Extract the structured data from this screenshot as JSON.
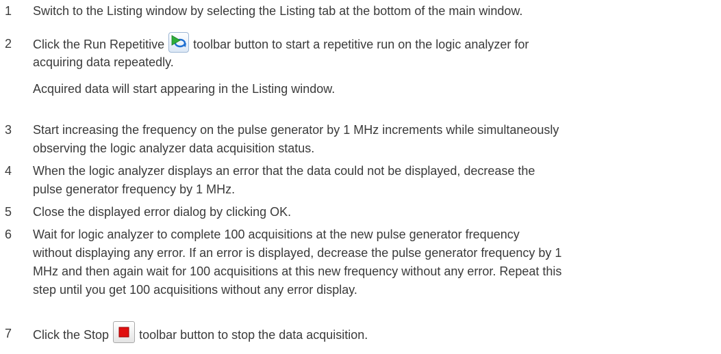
{
  "steps": [
    {
      "number": "1",
      "lines": [
        "Switch to the Listing window by selecting the Listing tab at the bottom of the main window."
      ]
    },
    {
      "number": "2",
      "line1_before": "Click the Run Repetitive",
      "line1_after": "toolbar button to start a repetitive run on the logic analyzer for",
      "line2": "acquiring data repeatedly.",
      "note": "Acquired data will start appearing in the Listing window.",
      "icon": "run-repetitive-icon"
    },
    {
      "number": "3",
      "lines": [
        "Start increasing the frequency on the pulse generator by 1 MHz increments while simultaneously",
        "observing the logic analyzer data acquisition status."
      ]
    },
    {
      "number": "4",
      "lines": [
        "When the logic analyzer displays an error that the data could not be displayed, decrease the",
        "pulse generator frequency by 1 MHz."
      ]
    },
    {
      "number": "5",
      "lines": [
        "Close the displayed error dialog by clicking OK."
      ]
    },
    {
      "number": "6",
      "lines": [
        "Wait for logic analyzer to complete 100 acquisitions at the new pulse generator frequency",
        "without displaying any error. If an error is displayed, decrease the pulse generator frequency by 1",
        "MHz and then again wait for 100 acquisitions at this new frequency without any error. Repeat this",
        "step until you get 100 acquisitions without any error display."
      ]
    },
    {
      "number": "7",
      "line1_before": "Click the Stop",
      "line1_after": "toolbar button to stop the data acquisition.",
      "icon": "stop-icon"
    }
  ],
  "colors": {
    "text": "#3a3a3a",
    "stop_red": "#e01010",
    "run_green": "#2fae3a",
    "run_blue": "#1f6fd1"
  }
}
